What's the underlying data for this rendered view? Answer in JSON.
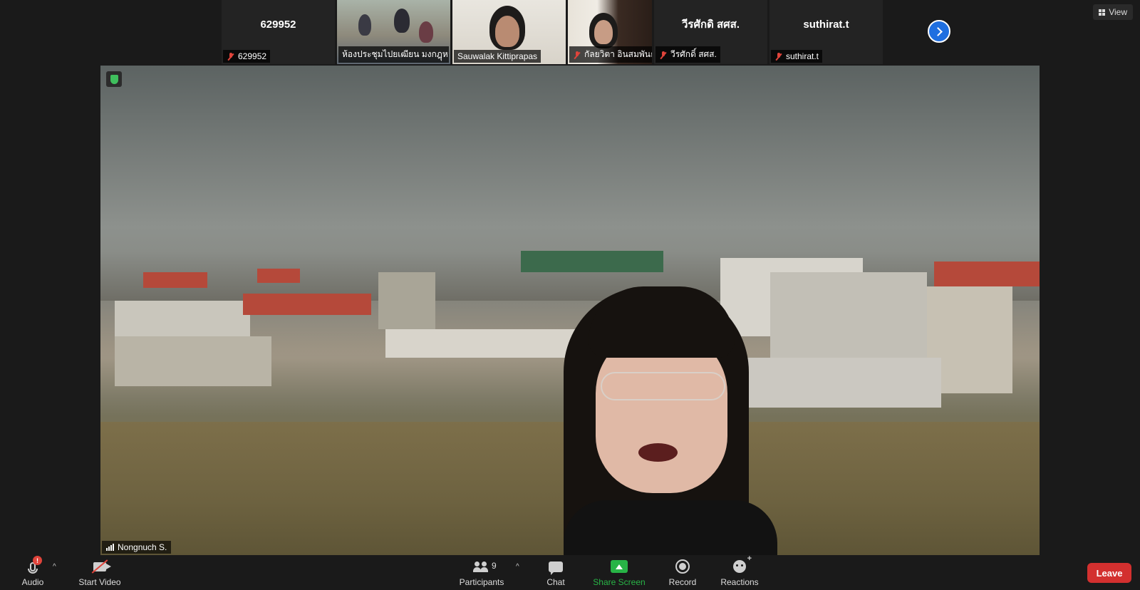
{
  "strip": {
    "tiles": [
      {
        "big": "629952",
        "caption": "629952",
        "muted": true
      },
      {
        "caption": "ห้องประชุมไปยเฒียน มงกฎุหอ...",
        "muted": false
      },
      {
        "caption": "Sauwalak Kittiprapas",
        "muted": false
      },
      {
        "caption": "กัลยวิตา อินสมพันธ์",
        "muted": true
      },
      {
        "big": "วีรศักดิ สศส.",
        "caption": "วีรศักดิ์ สศส.",
        "muted": true
      },
      {
        "big": "suthirat.t",
        "caption": "suthirat.t",
        "muted": true
      }
    ]
  },
  "view": {
    "label": "View"
  },
  "main": {
    "speaker_name": "Nongnuch S."
  },
  "toolbar": {
    "audio": "Audio",
    "audio_badge": "!",
    "start_video": "Start Video",
    "participants": "Participants",
    "participants_count": "9",
    "chat": "Chat",
    "share_screen": "Share Screen",
    "record": "Record",
    "reactions": "Reactions",
    "leave": "Leave"
  },
  "colors": {
    "share_green": "#28b446",
    "leave_red": "#d3302f",
    "accent_blue": "#1f6fe0",
    "muted_red": "#e0443b"
  }
}
